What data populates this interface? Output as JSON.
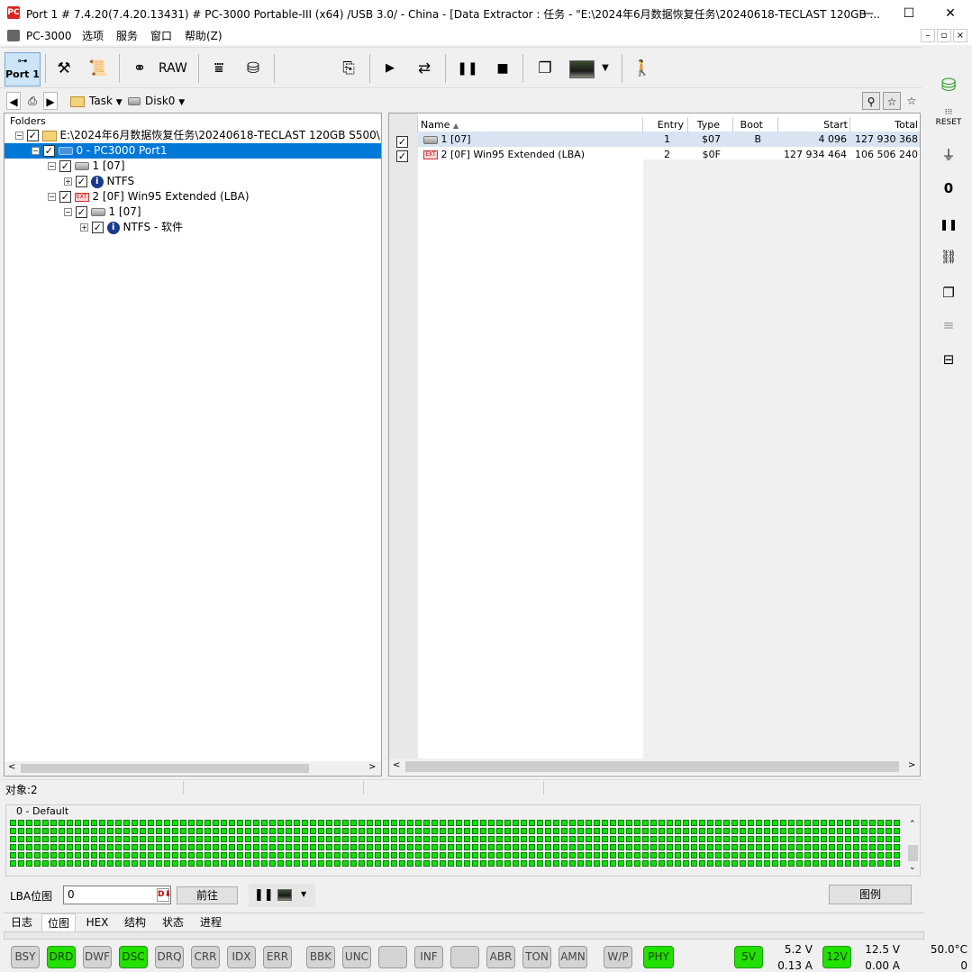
{
  "titlebar": {
    "icon": "pc3000-app-icon",
    "title": "Port 1 # 7.4.20(7.4.20.13431) # PC-3000 Portable-III (x64) /USB 3.0/ - China - [Data Extractor : 任务 - \"E:\\2024年6月数据恢复任务\\20240618-TECLAST 120GB ...",
    "minimize": "—",
    "maximize": "☐",
    "close": "✕"
  },
  "menu": {
    "items": [
      "PC-3000",
      "选项",
      "服务",
      "窗口",
      "帮助(Z)"
    ],
    "mdi_min": "–",
    "mdi_restore": "▫",
    "mdi_close": "×"
  },
  "toolbar": {
    "port_label": "Port 1",
    "raw_label": "RAW",
    "icons": [
      "tools-icon",
      "script-icon",
      "binoculars-icon",
      "raw-icon",
      "merge-icon",
      "disk-copy-icon",
      "export-icon",
      "play-icon",
      "flow-icon",
      "pause-icon",
      "stop-icon",
      "windows-icon",
      "image-icon",
      "dropdown-icon",
      "exit-icon"
    ]
  },
  "nav": {
    "task_label": "Task",
    "disk_label": "Disk0"
  },
  "tree": {
    "header": "Folders",
    "root": "E:\\2024年6月数据恢复任务\\20240618-TECLAST 120GB S500\\",
    "port": "0 - PC3000 Port1",
    "part1": "1 [07]",
    "ntfs1": "NTFS",
    "part2": "2 [0F] Win95 Extended  (LBA)",
    "part2_1": "1 [07]",
    "ntfs2": "NTFS - 软件"
  },
  "table": {
    "columns": [
      "Name",
      "Entry",
      "Type",
      "Boot",
      "Start",
      "Total"
    ],
    "rows": [
      {
        "name": "1 [07]",
        "entry": "1",
        "type": "$07",
        "boot": "B",
        "start": "4 096",
        "total": "127 930 368"
      },
      {
        "name": "2 [0F] Win95 Extended  (LBA)",
        "entry": "2",
        "type": "$0F",
        "boot": "",
        "start": "127 934 464",
        "total": "106 506 240"
      }
    ]
  },
  "status": {
    "objects": "对象:2"
  },
  "bitmap": {
    "title": "0 - Default",
    "lba_label": "LBA位图",
    "lba_value": "0",
    "goto_label": "前往",
    "legend_label": "图例",
    "fill_color": "#0be400"
  },
  "tabs": [
    "日志",
    "位图",
    "HEX",
    "结构",
    "状态",
    "进程"
  ],
  "leds": [
    {
      "label": "BSY",
      "on": false
    },
    {
      "label": "DRD",
      "on": true
    },
    {
      "label": "DWF",
      "on": false
    },
    {
      "label": "DSC",
      "on": true
    },
    {
      "label": "DRQ",
      "on": false
    },
    {
      "label": "CRR",
      "on": false
    },
    {
      "label": "IDX",
      "on": false
    },
    {
      "label": "ERR",
      "on": false
    },
    {
      "label": "BBK",
      "on": false
    },
    {
      "label": "UNC",
      "on": false
    },
    {
      "label": "",
      "on": false
    },
    {
      "label": "INF",
      "on": false
    },
    {
      "label": "",
      "on": false
    },
    {
      "label": "ABR",
      "on": false
    },
    {
      "label": "TON",
      "on": false
    },
    {
      "label": "AMN",
      "on": false
    },
    {
      "label": "W/P",
      "on": false
    },
    {
      "label": "PHY",
      "on": true
    }
  ],
  "power": {
    "v5_label": "5V",
    "v5_volt": "5.2 V",
    "v5_amp": "0.13 A",
    "v12_label": "12V",
    "v12_volt": "12.5 V",
    "v12_amp": "0.00 A",
    "temp": "50.0°C",
    "temp_sub": "0"
  }
}
